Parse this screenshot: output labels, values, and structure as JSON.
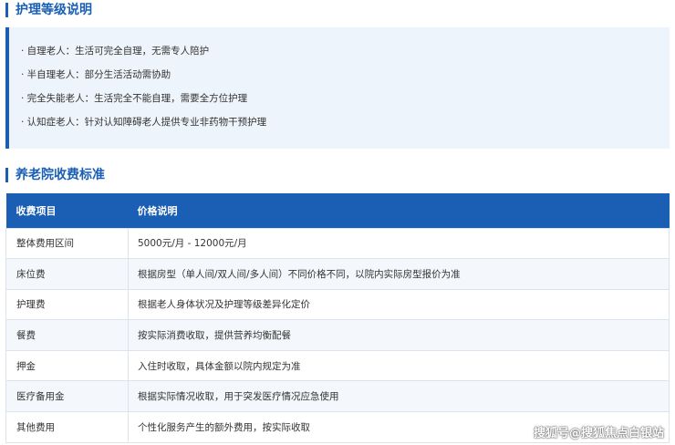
{
  "care_section": {
    "title": "护理等级说明",
    "items": [
      "· 自理老人：生活可完全自理，无需专人陪护",
      "· 半自理老人：部分生活活动需协助",
      "· 完全失能老人：生活完全不能自理，需要全方位护理",
      "· 认知症老人：针对认知障碍老人提供专业非药物干预护理"
    ]
  },
  "fee_section": {
    "title": "养老院收费标准",
    "headers": [
      "收费项目",
      "价格说明"
    ],
    "rows": [
      [
        "整体费用区间",
        "5000元/月 - 12000元/月"
      ],
      [
        "床位费",
        "根据房型（单人间/双人间/多人间）不同价格不同，以院内实际房型报价为准"
      ],
      [
        "护理费",
        "根据老人身体状况及护理等级差异化定价"
      ],
      [
        "餐费",
        "按实际消费收取，提供营养均衡配餐"
      ],
      [
        "押金",
        "入住时收取，具体金额以院内规定为准"
      ],
      [
        "医疗备用金",
        "根据实际情况收取，用于突发医疗情况应急使用"
      ],
      [
        "其他费用",
        "个性化服务产生的额外费用，按实际收取"
      ]
    ]
  },
  "watermark": "搜狐号@搜狐焦点白银站",
  "colors": {
    "accent": "#1a5fb4",
    "box_bg": "#eef4fb",
    "row_alt": "#f4f7fb"
  }
}
